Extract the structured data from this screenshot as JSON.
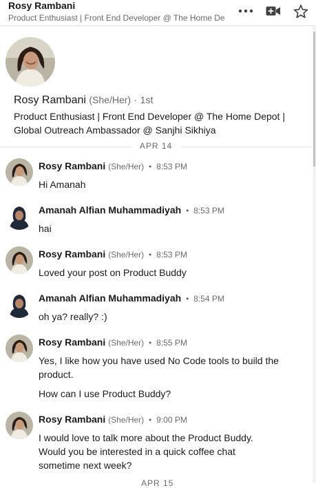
{
  "header": {
    "name": "Rosy Rambani",
    "subtitle": "Product Enthusiast | Front End Developer @ The Home Depot | Global Outreach Ambassador @ Sanjhi Sikhiya"
  },
  "profile": {
    "name": "Rosy Rambani",
    "pronouns": "(She/Her)",
    "dot": "·",
    "degree": "1st",
    "headline": "Product Enthusiast | Front End Developer @ The Home Depot | Global Outreach Ambassador @ Sanjhi Sikhiya"
  },
  "date_divider": "APR 14",
  "next_date_divider": "APR 15",
  "messages": [
    {
      "sender": "Rosy Rambani",
      "pronouns": "(She/Her)",
      "dot": "•",
      "time": "8:53 PM",
      "lines": [
        "Hi Amanah"
      ]
    },
    {
      "sender": "Amanah Alfian Muhammadiyah",
      "pronouns": "",
      "dot": "•",
      "time": "8:53 PM",
      "lines": [
        "hai"
      ]
    },
    {
      "sender": "Rosy Rambani",
      "pronouns": "(She/Her)",
      "dot": "•",
      "time": "8:53 PM",
      "lines": [
        "Loved your post on Product Buddy"
      ]
    },
    {
      "sender": "Amanah Alfian Muhammadiyah",
      "pronouns": "",
      "dot": "•",
      "time": "8:54 PM",
      "lines": [
        "oh ya? really? :)"
      ]
    },
    {
      "sender": "Rosy Rambani",
      "pronouns": "(She/Her)",
      "dot": "•",
      "time": "8:55 PM",
      "lines": [
        "Yes, I like how you have used No Code tools to build the product.",
        "How can I use Product Buddy?"
      ]
    },
    {
      "sender": "Rosy Rambani",
      "pronouns": "(She/Her)",
      "dot": "•",
      "time": "9:00 PM",
      "lines": [
        "I would love to talk more about the Product Buddy. Would you be interested in a quick coffee chat sometime next week?"
      ]
    }
  ],
  "icons": {
    "more": "more-icon",
    "video": "video-call-icon",
    "star": "star-icon"
  }
}
